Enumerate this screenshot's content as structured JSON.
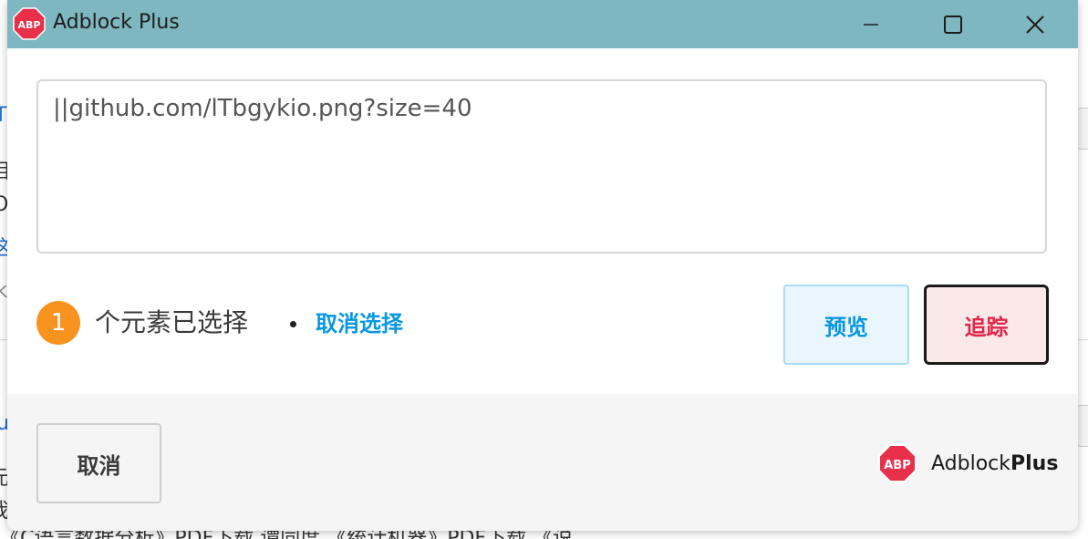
{
  "background": {
    "fragments": [
      "T",
      "相",
      "O",
      "这,",
      "K",
      "u",
      "元",
      "我"
    ],
    "bottom_line": "《C语言数据分析》PDF下载 谭同度 《统计机器》PDF下载 《说"
  },
  "window": {
    "title": "Adblock Plus",
    "logo_text": "ABP",
    "controls": [
      "minimize-icon",
      "maximize-icon",
      "close-icon"
    ]
  },
  "filter": {
    "value": "||github.com/lTbgykio.png?size=40"
  },
  "selection": {
    "count": "1",
    "text": "个元素已选择",
    "deselect_label": "取消选择"
  },
  "actions": {
    "preview_label": "预览",
    "track_label": "追踪",
    "cancel_label": "取消"
  },
  "brand": {
    "logo_text": "ABP",
    "name_regular": "Adblock",
    "name_bold": "Plus"
  },
  "colors": {
    "titlebar": "#7fb7c0",
    "badge": "#f7931e",
    "link": "#0797e1",
    "track": "#e0284a",
    "abp_red": "#e8304a"
  }
}
